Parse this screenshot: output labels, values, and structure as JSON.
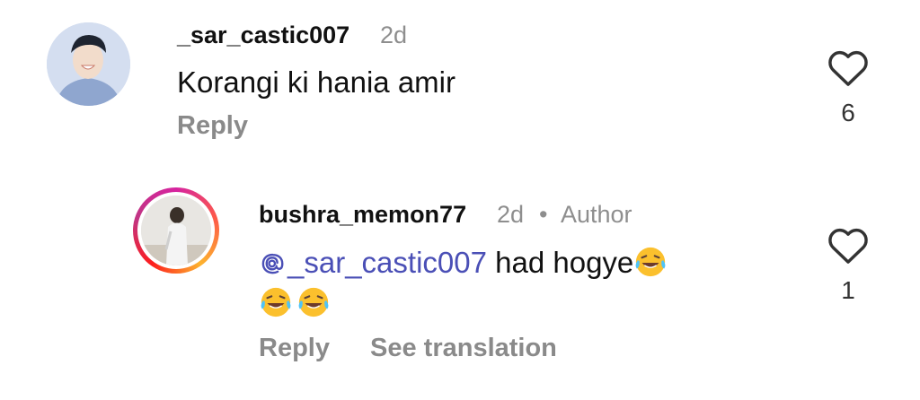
{
  "comment": {
    "username": "_sar_castic007",
    "time": "2d",
    "text": "Korangi ki hania amir",
    "reply_label": "Reply",
    "like_count": "6",
    "avatar_icon": "user-avatar"
  },
  "reply": {
    "username": "bushra_memon77",
    "time": "2d",
    "separator": "•",
    "author_badge": "Author",
    "mention_icon": "threads-at-icon",
    "mention": "_sar_castic007",
    "text": "had hogye",
    "emoji": "laughing-tears-emoji",
    "reply_label": "Reply",
    "translate_label": "See translation",
    "like_count": "1",
    "avatar_icon": "user-avatar-story-ring"
  },
  "colors": {
    "mention": "#4a4fb6",
    "secondary_text": "#8e8e8e",
    "action_text": "#8a8a8a",
    "story_ring": [
      "#d6249f",
      "#fd5949",
      "#fdb32e"
    ]
  }
}
